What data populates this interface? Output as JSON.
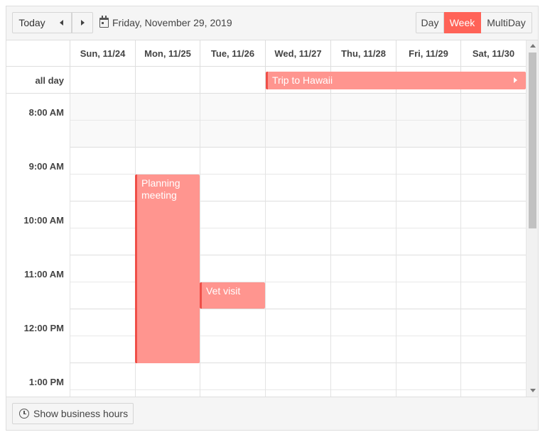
{
  "toolbar": {
    "today_label": "Today",
    "current_date": "Friday, November 29, 2019",
    "views": [
      {
        "label": "Day",
        "selected": false
      },
      {
        "label": "Week",
        "selected": true
      },
      {
        "label": "MultiDay",
        "selected": false
      }
    ]
  },
  "days": [
    {
      "label": "Sun, 11/24"
    },
    {
      "label": "Mon, 11/25"
    },
    {
      "label": "Tue, 11/26"
    },
    {
      "label": "Wed, 11/27"
    },
    {
      "label": "Thu, 11/28"
    },
    {
      "label": "Fri, 11/29"
    },
    {
      "label": "Sat, 11/30"
    }
  ],
  "allday": {
    "label": "all day",
    "event": {
      "title": "Trip to Hawaii",
      "start_day": "Wed, 11/27",
      "end_day": "Sat, 11/30"
    }
  },
  "time_slots": [
    "8:00 AM",
    "9:00 AM",
    "10:00 AM",
    "11:00 AM",
    "12:00 PM",
    "1:00 PM"
  ],
  "events": [
    {
      "title": "Planning meeting",
      "day": "Mon, 11/25",
      "start": "9:30 AM",
      "end": "1:00 PM"
    },
    {
      "title": "Vet visit",
      "day": "Tue, 11/26",
      "start": "11:30 AM",
      "end": "12:00 PM"
    }
  ],
  "footer": {
    "business_hours_label": "Show business hours"
  },
  "colors": {
    "accent": "#ff6358",
    "event_fill": "#ff958f",
    "event_border": "#ef4f48"
  }
}
